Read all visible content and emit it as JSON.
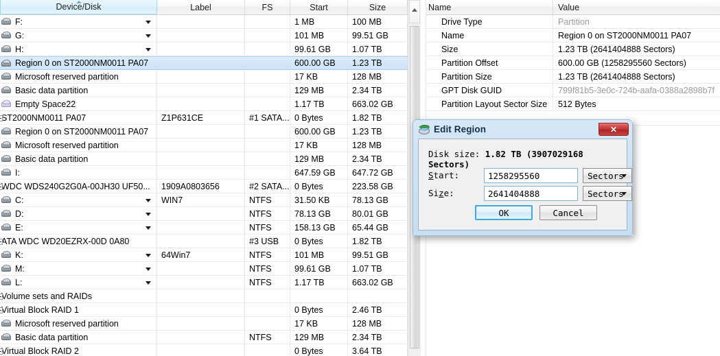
{
  "tree": {
    "columns": [
      {
        "key": "device",
        "label": "Device/Disk",
        "sorted": true
      },
      {
        "key": "label",
        "label": "Label",
        "sorted": false
      },
      {
        "key": "fs",
        "label": "FS",
        "sorted": false
      },
      {
        "key": "start",
        "label": "Start",
        "sorted": false
      },
      {
        "key": "size",
        "label": "Size",
        "sorted": false
      }
    ],
    "rows": [
      {
        "device": "F:",
        "label": "",
        "fs": "",
        "start": "1 MB",
        "size": "100 MB",
        "indent": 1,
        "icon": "disk-icon",
        "combo": true,
        "expander": "none",
        "selected": false
      },
      {
        "device": "G:",
        "label": "",
        "fs": "",
        "start": "101 MB",
        "size": "99.51 GB",
        "indent": 1,
        "icon": "disk-icon",
        "combo": true,
        "expander": "none",
        "selected": false
      },
      {
        "device": "H:",
        "label": "",
        "fs": "",
        "start": "99.61 GB",
        "size": "1.07 TB",
        "indent": 1,
        "icon": "disk-icon",
        "combo": true,
        "expander": "none",
        "selected": false
      },
      {
        "device": "Region 0 on ST2000NM0011 PA07",
        "label": "",
        "fs": "",
        "start": "600.00 GB",
        "size": "1.23 TB",
        "indent": 1,
        "icon": "disk-icon",
        "combo": false,
        "expander": "none",
        "selected": true
      },
      {
        "device": "Microsoft reserved partition",
        "label": "",
        "fs": "",
        "start": "17 KB",
        "size": "128 MB",
        "indent": 2,
        "icon": "disk-icon",
        "combo": false,
        "expander": "none",
        "selected": false
      },
      {
        "device": "Basic data partition",
        "label": "",
        "fs": "",
        "start": "129 MB",
        "size": "2.34 TB",
        "indent": 2,
        "icon": "disk-icon",
        "combo": false,
        "expander": "none",
        "selected": false
      },
      {
        "device": "Empty Space22",
        "label": "",
        "fs": "",
        "start": "1.17 TB",
        "size": "663.02 GB",
        "indent": 1,
        "icon": "empty-space-icon",
        "combo": false,
        "expander": "none",
        "selected": false
      },
      {
        "device": "ST2000NM0011 PA07",
        "label": "Z1P631CE",
        "fs": "#1 SATA...",
        "start": "0 Bytes",
        "size": "1.82 TB",
        "indent": 0,
        "icon": "none",
        "combo": false,
        "expander": "minus",
        "selected": false
      },
      {
        "device": "Region 0 on ST2000NM0011 PA07",
        "label": "",
        "fs": "",
        "start": "600.00 GB",
        "size": "1.23 TB",
        "indent": 1,
        "icon": "disk-icon",
        "combo": false,
        "expander": "none",
        "selected": false
      },
      {
        "device": "Microsoft reserved partition",
        "label": "",
        "fs": "",
        "start": "17 KB",
        "size": "128 MB",
        "indent": 2,
        "icon": "disk-icon",
        "combo": false,
        "expander": "none",
        "selected": false
      },
      {
        "device": "Basic data partition",
        "label": "",
        "fs": "",
        "start": "129 MB",
        "size": "2.34 TB",
        "indent": 2,
        "icon": "disk-icon",
        "combo": false,
        "expander": "none",
        "selected": false
      },
      {
        "device": "I:",
        "label": "",
        "fs": "",
        "start": "647.59 GB",
        "size": "647.72 GB",
        "indent": 1,
        "icon": "disk-icon",
        "combo": false,
        "expander": "none",
        "selected": false
      },
      {
        "device": "WDC WDS240G2G0A-00JH30 UF50...",
        "label": "1909A0803656",
        "fs": "#2 SATA...",
        "start": "0 Bytes",
        "size": "223.58 GB",
        "indent": 0,
        "icon": "none",
        "combo": false,
        "expander": "minus",
        "selected": false
      },
      {
        "device": "C:",
        "label": "WIN7",
        "fs": "NTFS",
        "start": "31.50 KB",
        "size": "78.13 GB",
        "indent": 1,
        "icon": "disk-icon",
        "combo": true,
        "expander": "none",
        "selected": false
      },
      {
        "device": "D:",
        "label": "",
        "fs": "NTFS",
        "start": "78.13 GB",
        "size": "80.01 GB",
        "indent": 1,
        "icon": "disk-icon",
        "combo": true,
        "expander": "none",
        "selected": false
      },
      {
        "device": "E:",
        "label": "",
        "fs": "NTFS",
        "start": "158.13 GB",
        "size": "65.44 GB",
        "indent": 1,
        "icon": "disk-icon",
        "combo": true,
        "expander": "none",
        "selected": false
      },
      {
        "device": "ATA WDC WD20EZRX-00D 0A80",
        "label": "",
        "fs": "#3 USB",
        "start": "0 Bytes",
        "size": "1.82 TB",
        "indent": 0,
        "icon": "none",
        "combo": false,
        "expander": "minus",
        "selected": false
      },
      {
        "device": "K:",
        "label": "64Win7",
        "fs": "NTFS",
        "start": "101 MB",
        "size": "99.51 GB",
        "indent": 1,
        "icon": "disk-icon",
        "combo": true,
        "expander": "none",
        "selected": false
      },
      {
        "device": "M:",
        "label": "",
        "fs": "NTFS",
        "start": "99.61 GB",
        "size": "1.07 TB",
        "indent": 1,
        "icon": "disk-icon",
        "combo": true,
        "expander": "none",
        "selected": false
      },
      {
        "device": "L:",
        "label": "",
        "fs": "NTFS",
        "start": "1.17 TB",
        "size": "663.02 GB",
        "indent": 1,
        "icon": "disk-icon",
        "combo": true,
        "expander": "none",
        "selected": false
      },
      {
        "device": "Volume sets and RAIDs",
        "label": "",
        "fs": "",
        "start": "",
        "size": "",
        "indent": 0,
        "icon": "none",
        "combo": false,
        "expander": "minus",
        "selected": false
      },
      {
        "device": "Virtual Block RAID 1",
        "label": "",
        "fs": "",
        "start": "0 Bytes",
        "size": "2.46 TB",
        "indent": 0,
        "icon": "none",
        "combo": false,
        "expander": "minus",
        "selected": false
      },
      {
        "device": "Microsoft reserved partition",
        "label": "",
        "fs": "",
        "start": "17 KB",
        "size": "128 MB",
        "indent": 1,
        "icon": "disk-icon",
        "combo": false,
        "expander": "none",
        "selected": false
      },
      {
        "device": "Basic data partition",
        "label": "",
        "fs": "NTFS",
        "start": "129 MB",
        "size": "2.34 TB",
        "indent": 1,
        "icon": "disk-icon",
        "combo": false,
        "expander": "none",
        "selected": false
      },
      {
        "device": "Virtual Block RAID 2",
        "label": "",
        "fs": "",
        "start": "0 Bytes",
        "size": "3.64 TB",
        "indent": 0,
        "icon": "none",
        "combo": false,
        "expander": "minus",
        "selected": false
      }
    ]
  },
  "scrollbar": {
    "up_arrow": "scroll-up-arrow-icon"
  },
  "properties": {
    "columns": [
      {
        "key": "name",
        "label": "Name"
      },
      {
        "key": "value",
        "label": "Value"
      }
    ],
    "rows": [
      {
        "name": "Drive Type",
        "value": "Partition",
        "dim": true
      },
      {
        "name": "Name",
        "value": "Region 0 on ST2000NM0011 PA07",
        "dim": false
      },
      {
        "name": "Size",
        "value": "1.23 TB (2641404888 Sectors)",
        "dim": false
      },
      {
        "name": "Partition Offset",
        "value": "600.00 GB (1258295560 Sectors)",
        "dim": false
      },
      {
        "name": "Partition Size",
        "value": "1.23 TB (2641404888 Sectors)",
        "dim": false
      },
      {
        "name": "GPT Disk GUID",
        "value": "799f81b5-3e0c-724b-aafa-0388a2898b7f",
        "dim": true
      },
      {
        "name": "Partition Layout Sector Size",
        "value": "512 Bytes",
        "dim": false
      }
    ]
  },
  "dialog": {
    "title": "Edit Region",
    "title_icon": "edit-region-icon",
    "close_label": "✕",
    "disk_size_label": "Disk size:",
    "disk_size_value": "1.82 TB (3907029168 Sectors)",
    "start": {
      "label_prefix": "",
      "label_accel": "S",
      "label_suffix": "tart:",
      "value": "1258295560",
      "unit": "Sectors"
    },
    "size": {
      "label_prefix": "Si",
      "label_accel": "z",
      "label_suffix": "e:",
      "value": "2641404888",
      "unit": "Sectors"
    },
    "ok_label": "OK",
    "cancel_label": "Cancel"
  },
  "colors": {
    "selection_blue": "#cde3f8",
    "header_sorted": "#dff3fc",
    "close_red": "#c03434",
    "focus_blue": "#3ca9e0",
    "dim_text": "#9a9a9a"
  }
}
